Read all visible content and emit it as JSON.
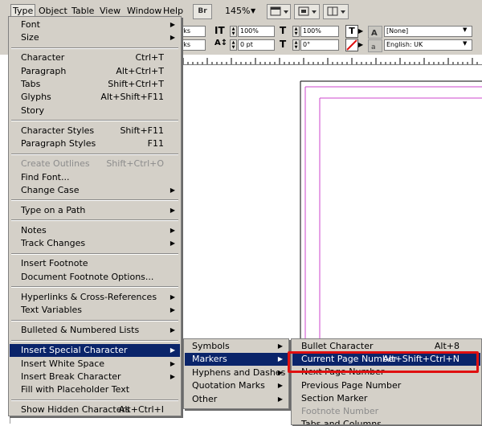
{
  "menubar": {
    "items": [
      "Type",
      "Object",
      "Table",
      "View",
      "Window",
      "Help"
    ],
    "active": "Type",
    "br_label": "Br",
    "zoom": "145%"
  },
  "control_panel": {
    "font_size_fragment": "rks",
    "leading_fragment": "rks",
    "scale_v": "100%",
    "scale_h": "100%",
    "tracking": "0 pt",
    "kerning": "0°",
    "char_style": "[None]",
    "language": "English: UK"
  },
  "type_menu": {
    "groups": [
      [
        {
          "label": "Font",
          "sub": true
        },
        {
          "label": "Size",
          "sub": true
        }
      ],
      [
        {
          "label": "Character",
          "shortcut": "Ctrl+T"
        },
        {
          "label": "Paragraph",
          "shortcut": "Alt+Ctrl+T"
        },
        {
          "label": "Tabs",
          "shortcut": "Shift+Ctrl+T"
        },
        {
          "label": "Glyphs",
          "shortcut": "Alt+Shift+F11"
        },
        {
          "label": "Story"
        }
      ],
      [
        {
          "label": "Character Styles",
          "shortcut": "Shift+F11"
        },
        {
          "label": "Paragraph Styles",
          "shortcut": "F11"
        }
      ],
      [
        {
          "label": "Create Outlines",
          "shortcut": "Shift+Ctrl+O",
          "disabled": true
        },
        {
          "label": "Find Font..."
        },
        {
          "label": "Change Case",
          "sub": true
        }
      ],
      [
        {
          "label": "Type on a Path",
          "sub": true
        }
      ],
      [
        {
          "label": "Notes",
          "sub": true
        },
        {
          "label": "Track Changes",
          "sub": true
        }
      ],
      [
        {
          "label": "Insert Footnote"
        },
        {
          "label": "Document Footnote Options..."
        }
      ],
      [
        {
          "label": "Hyperlinks & Cross-References",
          "sub": true
        },
        {
          "label": "Text Variables",
          "sub": true
        }
      ],
      [
        {
          "label": "Bulleted & Numbered Lists",
          "sub": true
        }
      ],
      [
        {
          "label": "Insert Special Character",
          "sub": true,
          "highlighted": true
        },
        {
          "label": "Insert White Space",
          "sub": true
        },
        {
          "label": "Insert Break Character",
          "sub": true
        },
        {
          "label": "Fill with Placeholder Text"
        }
      ],
      [
        {
          "label": "Show Hidden Characters",
          "shortcut": "Alt+Ctrl+I"
        }
      ]
    ]
  },
  "special_menu": {
    "items": [
      {
        "label": "Symbols",
        "sub": true
      },
      {
        "label": "Markers",
        "sub": true,
        "highlighted": true
      },
      {
        "label": "Hyphens and Dashes",
        "sub": true
      },
      {
        "label": "Quotation Marks",
        "sub": true
      },
      {
        "label": "Other",
        "sub": true
      }
    ]
  },
  "markers_menu": {
    "items": [
      {
        "label": "Bullet Character",
        "shortcut": "Alt+8"
      },
      {
        "label": "Current Page Number",
        "shortcut": "Alt+Shift+Ctrl+N",
        "highlighted": true
      },
      {
        "label": "Next Page Number"
      },
      {
        "label": "Previous Page Number"
      },
      {
        "label": "Section Marker"
      },
      {
        "label": "Footnote Number",
        "disabled": true
      }
    ],
    "cut_off_label": "Tabs and Columns"
  },
  "colors": {
    "menu_bg": "#d4d0c8",
    "highlight": "#0a246a",
    "callout": "#e01010",
    "margin_guide": "#cc44cc",
    "page_edge": "#000000"
  }
}
